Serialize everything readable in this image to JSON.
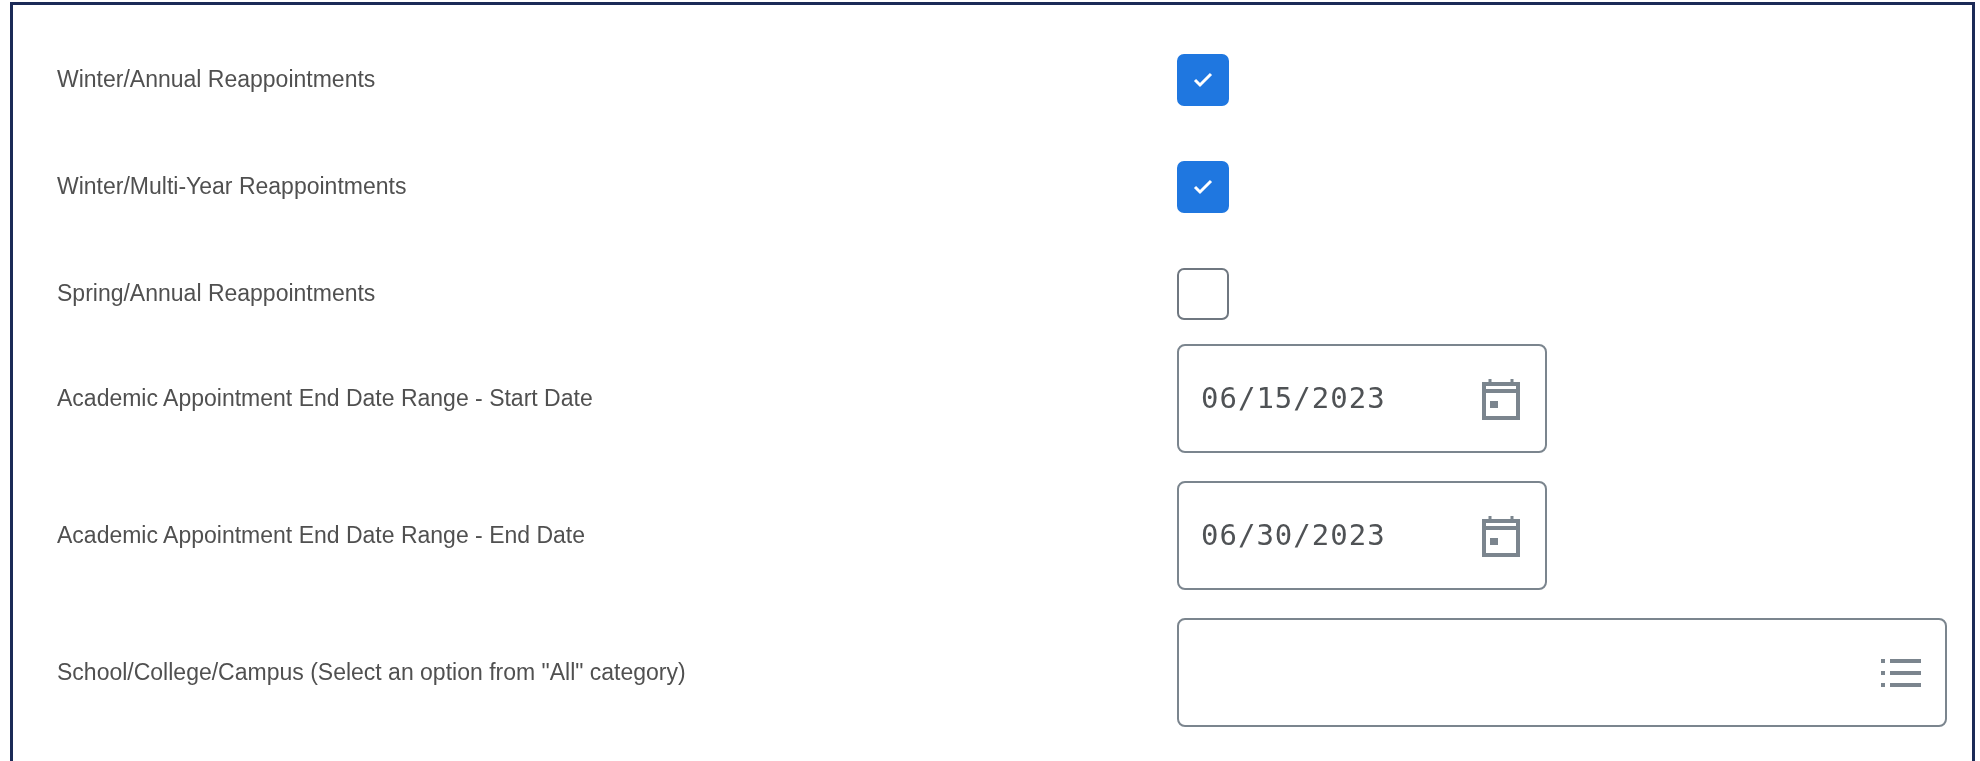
{
  "fields": [
    {
      "kind": "checkbox",
      "label": "Winter/Annual Reappointments",
      "checked": true
    },
    {
      "kind": "checkbox",
      "label": "Winter/Multi-Year Reappointments",
      "checked": true
    },
    {
      "kind": "checkbox",
      "label": "Spring/Annual Reappointments",
      "checked": false
    },
    {
      "kind": "date",
      "label": "Academic Appointment End Date Range - Start Date",
      "value": "06/15/2023"
    },
    {
      "kind": "date",
      "label": "Academic Appointment End Date Range - End Date",
      "value": "06/30/2023"
    },
    {
      "kind": "select",
      "label": "School/College/Campus (Select an option from \"All\" category)"
    }
  ]
}
